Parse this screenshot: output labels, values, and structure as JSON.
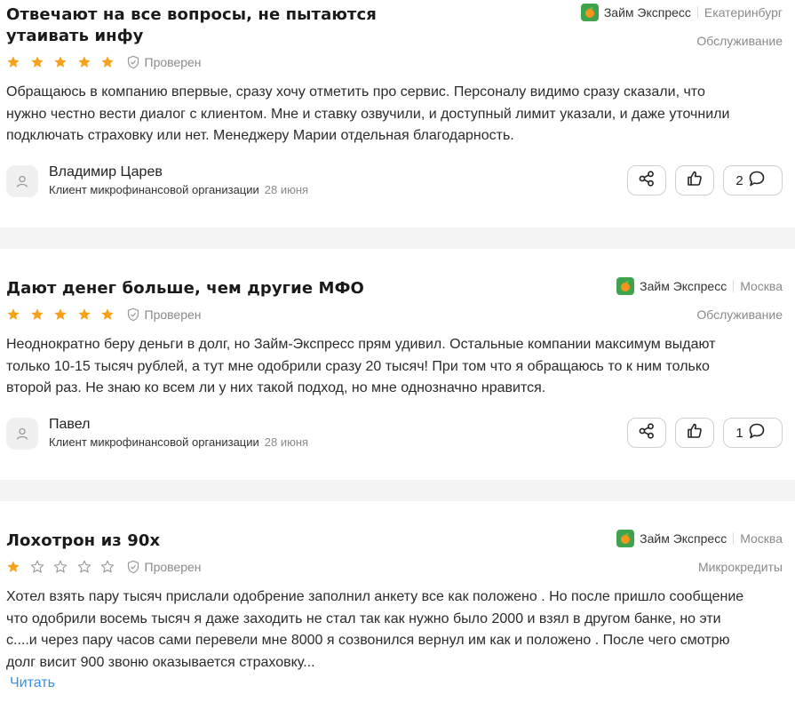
{
  "colors": {
    "star_filled": "#f7a11a",
    "star_empty": "#9a9a9a",
    "brand": "#3fa34d",
    "link": "#3a8fe0"
  },
  "reviews": [
    {
      "title_line1": "Отвечают на все вопросы, не пытаются",
      "title_line2": "утаивать инфу",
      "brand": "Займ Экспресс",
      "city": "Екатеринбург",
      "category": "Обслуживание",
      "rating": 5,
      "verified": "Проверен",
      "text": [
        "Обращаюсь в компанию впервые, сразу хочу отметить про сервис. Персоналу видимо сразу сказали, что",
        "нужно честно вести диалог с клиентом. Мне и ставку озвучили, и доступный лимит указали, и даже уточнили",
        "подключать страховку или нет. Менеджеру Марии отдельная благодарность."
      ],
      "author": "Владимир Царев",
      "author_role": "Клиент микрофинансовой организации",
      "date": "28 июня",
      "comments": "2",
      "icons": {
        "avatar": "user-icon",
        "share": "share-icon",
        "like": "thumbs-up-icon",
        "comment": "comment-icon"
      }
    },
    {
      "title": "Дают денег больше, чем другие МФО",
      "brand": "Займ Экспресс",
      "city": "Москва",
      "category": "Обслуживание",
      "rating": 5,
      "verified": "Проверен",
      "text": [
        "Неоднократно беру деньги в долг, но Займ-Экспресс прям удивил. Остальные компании максимум выдают",
        "только 10-15 тысяч рублей, а тут мне одобрили сразу 20 тысяч! При том что я обращаюсь то к ним только",
        "второй раз. Не знаю ко всем ли у них такой подход, но мне однозначно нравится."
      ],
      "author": "Павел",
      "author_role": "Клиент микрофинансовой организации",
      "date": "28 июня",
      "comments": "1"
    },
    {
      "title": "Лохотрон из 90х",
      "brand": "Займ Экспресс",
      "city": "Москва",
      "category": "Микрокредиты",
      "rating": 1,
      "verified": "Проверен",
      "text": [
        "Хотел взять пару тысяч прислали одобрение заполнил анкету все как положено . Но после пришло сообщение",
        "что одобрили восемь тысяч я даже заходить не стал так как нужно было 2000 и взял в другом банке, но эти",
        "с....и через пару часов сами перевели мне 8000 я созвонился вернул им как и положено . После чего смотрю",
        "долг висит 900 звоню оказывается страховку..."
      ],
      "read_more": "Читать"
    }
  ]
}
